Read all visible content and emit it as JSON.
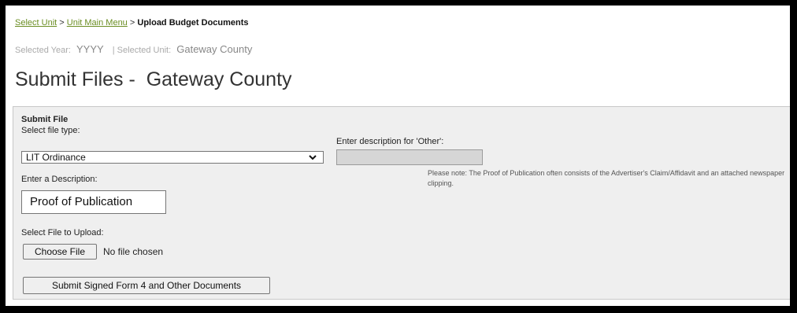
{
  "breadcrumb": {
    "select_unit": "Select Unit",
    "sep1": ">",
    "unit_main_menu": "Unit Main Menu",
    "sep2": ">",
    "current": "Upload Budget Documents"
  },
  "meta": {
    "year_label": "Selected Year:",
    "year_value": "YYYY",
    "unit_label": "| Selected Unit:",
    "unit_value": "Gateway County"
  },
  "page_title": "Submit Files -  Gateway County",
  "form": {
    "heading": "Submit File",
    "file_type_label": "Select file type:",
    "file_type_value": "LIT Ordinance",
    "other_label": "Enter description for 'Other':",
    "other_value": "",
    "description_label": "Enter a Description:",
    "description_value": "Proof of Publication",
    "note": "Please note: The Proof of Publication often consists of the Advertiser's Claim/Affidavit and an attached newspaper clipping.",
    "upload_label": "Select File to Upload:",
    "choose_file_label": "Choose File",
    "no_file_text": "No file chosen",
    "submit_label": "Submit Signed Form 4 and Other Documents"
  },
  "colors": {
    "link": "#6b8e23",
    "panel_bg": "#efefef",
    "frame_border": "#000000"
  }
}
